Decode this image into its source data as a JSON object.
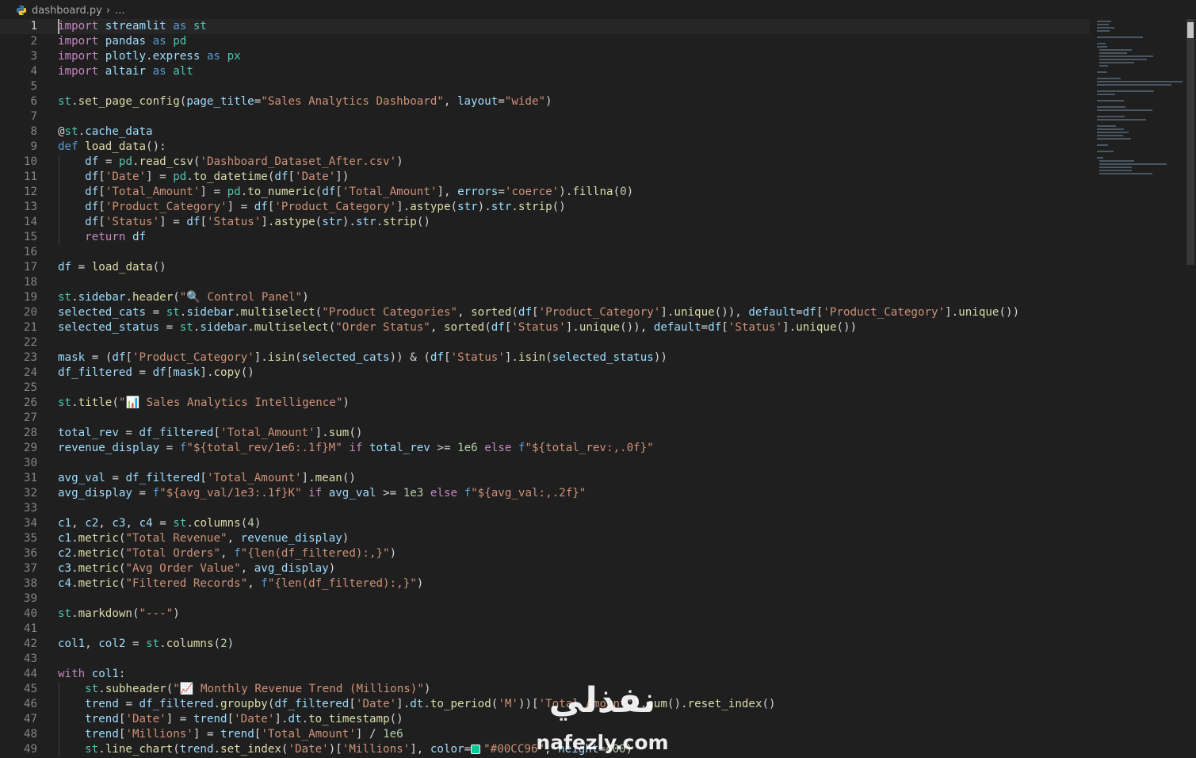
{
  "breadcrumb": {
    "file_name": "dashboard.py",
    "more": "..."
  },
  "editor": {
    "current_line": 1,
    "lines": [
      {
        "n": "1",
        "t": "import streamlit as st"
      },
      {
        "n": "2",
        "t": "import pandas as pd"
      },
      {
        "n": "3",
        "t": "import plotly.express as px"
      },
      {
        "n": "4",
        "t": "import altair as alt"
      },
      {
        "n": "5",
        "t": ""
      },
      {
        "n": "6",
        "t": "st.set_page_config(page_title=\"Sales Analytics Dashboard\", layout=\"wide\")"
      },
      {
        "n": "7",
        "t": ""
      },
      {
        "n": "8",
        "t": "@st.cache_data"
      },
      {
        "n": "9",
        "t": "def load_data():"
      },
      {
        "n": "10",
        "t": "    df = pd.read_csv('Dashboard_Dataset_After.csv')"
      },
      {
        "n": "11",
        "t": "    df['Date'] = pd.to_datetime(df['Date'])"
      },
      {
        "n": "12",
        "t": "    df['Total_Amount'] = pd.to_numeric(df['Total_Amount'], errors='coerce').fillna(0)"
      },
      {
        "n": "13",
        "t": "    df['Product_Category'] = df['Product_Category'].astype(str).str.strip()"
      },
      {
        "n": "14",
        "t": "    df['Status'] = df['Status'].astype(str).str.strip()"
      },
      {
        "n": "15",
        "t": "    return df"
      },
      {
        "n": "16",
        "t": ""
      },
      {
        "n": "17",
        "t": "df = load_data()"
      },
      {
        "n": "18",
        "t": ""
      },
      {
        "n": "19",
        "t": "st.sidebar.header(\"🔍 Control Panel\")"
      },
      {
        "n": "20",
        "t": "selected_cats = st.sidebar.multiselect(\"Product Categories\", sorted(df['Product_Category'].unique()), default=df['Product_Category'].unique())"
      },
      {
        "n": "21",
        "t": "selected_status = st.sidebar.multiselect(\"Order Status\", sorted(df['Status'].unique()), default=df['Status'].unique())"
      },
      {
        "n": "22",
        "t": ""
      },
      {
        "n": "23",
        "t": "mask = (df['Product_Category'].isin(selected_cats)) & (df['Status'].isin(selected_status))"
      },
      {
        "n": "24",
        "t": "df_filtered = df[mask].copy()"
      },
      {
        "n": "25",
        "t": ""
      },
      {
        "n": "26",
        "t": "st.title(\"📊 Sales Analytics Intelligence\")"
      },
      {
        "n": "27",
        "t": ""
      },
      {
        "n": "28",
        "t": "total_rev = df_filtered['Total_Amount'].sum()"
      },
      {
        "n": "29",
        "t": "revenue_display = f\"${total_rev/1e6:.1f}M\" if total_rev >= 1e6 else f\"${total_rev:,.0f}\""
      },
      {
        "n": "30",
        "t": ""
      },
      {
        "n": "31",
        "t": "avg_val = df_filtered['Total_Amount'].mean()"
      },
      {
        "n": "32",
        "t": "avg_display = f\"${avg_val/1e3:.1f}K\" if avg_val >= 1e3 else f\"${avg_val:,.2f}\""
      },
      {
        "n": "33",
        "t": ""
      },
      {
        "n": "34",
        "t": "c1, c2, c3, c4 = st.columns(4)"
      },
      {
        "n": "35",
        "t": "c1.metric(\"Total Revenue\", revenue_display)"
      },
      {
        "n": "36",
        "t": "c2.metric(\"Total Orders\", f\"{len(df_filtered):,}\")"
      },
      {
        "n": "37",
        "t": "c3.metric(\"Avg Order Value\", avg_display)"
      },
      {
        "n": "38",
        "t": "c4.metric(\"Filtered Records\", f\"{len(df_filtered):,}\")"
      },
      {
        "n": "39",
        "t": ""
      },
      {
        "n": "40",
        "t": "st.markdown(\"---\")"
      },
      {
        "n": "41",
        "t": ""
      },
      {
        "n": "42",
        "t": "col1, col2 = st.columns(2)"
      },
      {
        "n": "43",
        "t": ""
      },
      {
        "n": "44",
        "t": "with col1:"
      },
      {
        "n": "45",
        "t": "    st.subheader(\"📈 Monthly Revenue Trend (Millions)\")"
      },
      {
        "n": "46",
        "t": "    trend = df_filtered.groupby(df_filtered['Date'].dt.to_period('M'))['Total_Amount'].sum().reset_index()"
      },
      {
        "n": "47",
        "t": "    trend['Date'] = trend['Date'].dt.to_timestamp()"
      },
      {
        "n": "48",
        "t": "    trend['Millions'] = trend['Total_Amount'] / 1e6"
      },
      {
        "n": "49",
        "t": "    st.line_chart(trend.set_index('Date')['Millions'], color=\"#00CC96\", height=400)"
      }
    ]
  },
  "colors": {
    "swatch_color": "#00CC96",
    "background": "#1f1f1f",
    "keyword": "#569cd6",
    "string": "#ce9178"
  },
  "watermark": {
    "arabic": "نفذلي",
    "latin": "nafezly.com"
  }
}
